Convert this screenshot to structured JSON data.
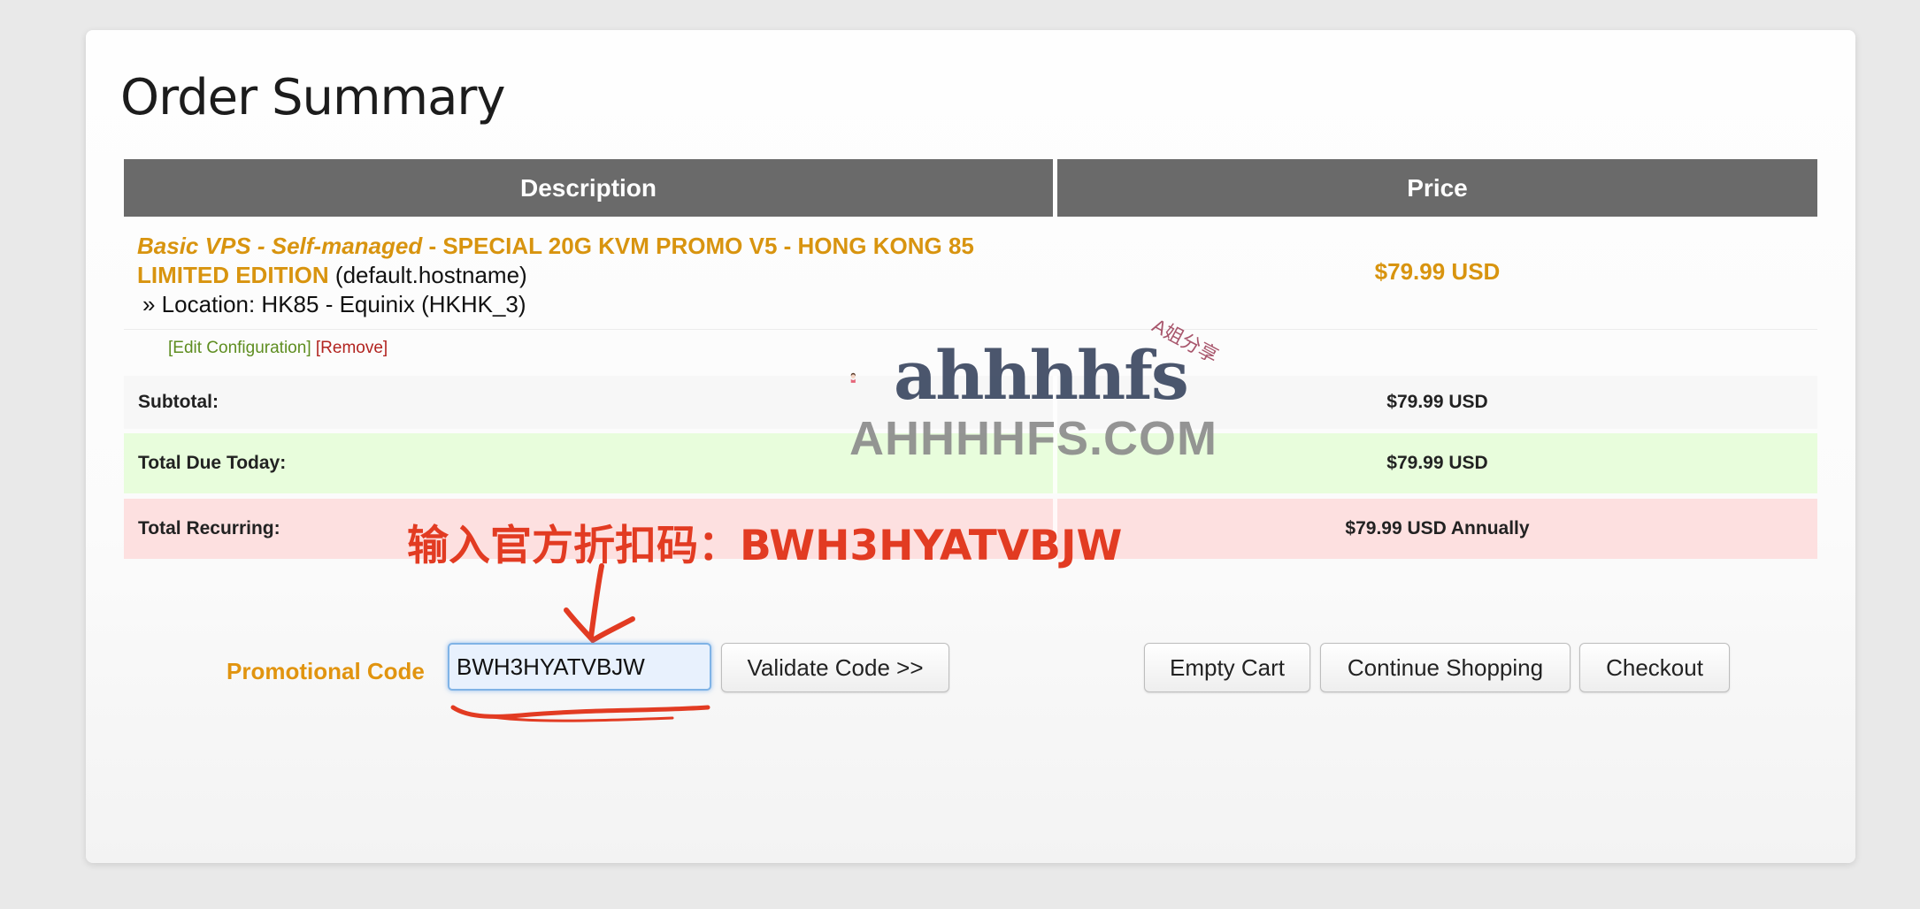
{
  "page_title": "Order Summary",
  "table": {
    "headers": {
      "description": "Description",
      "price": "Price"
    },
    "item": {
      "product_group": "Basic VPS - Self-managed",
      "separator": " - ",
      "product_name": "SPECIAL 20G KVM PROMO V5 - HONG KONG 85 LIMITED EDITION",
      "hostname": "(default.hostname)",
      "location": "» Location: HK85 - Equinix (HKHK_3)",
      "price": "$79.99 USD",
      "edit_link": "[Edit Configuration]",
      "remove_link": "[Remove]"
    },
    "summary": [
      {
        "label": "Subtotal:",
        "value": "$79.99 USD",
        "status": "neutral"
      },
      {
        "label": "Total Due Today:",
        "value": "$79.99 USD",
        "status": "success",
        "color": "#e8fddc"
      },
      {
        "label": "Total Recurring:",
        "value": "$79.99 USD Annually",
        "status": "danger",
        "color": "#fde0e0"
      }
    ]
  },
  "promo": {
    "label": "Promotional Code",
    "value": "BWH3HYATVBJW",
    "validate_button": "Validate Code >>"
  },
  "actions": {
    "empty_cart": "Empty Cart",
    "continue_shopping": "Continue Shopping",
    "checkout": "Checkout"
  },
  "annotation": {
    "text": "输入官方折扣码：BWH3HYATVBJW",
    "color": "#e23b22"
  },
  "watermark": {
    "logo_text": "ahhhhfs",
    "logo_subtext": "A姐分享",
    "site_text": "AHHHHFS.COM"
  },
  "colors": {
    "accent_orange": "#d8940f",
    "header_bg": "#6a6a6a",
    "edit_link": "#5e8d20",
    "remove_link": "#b22420"
  }
}
